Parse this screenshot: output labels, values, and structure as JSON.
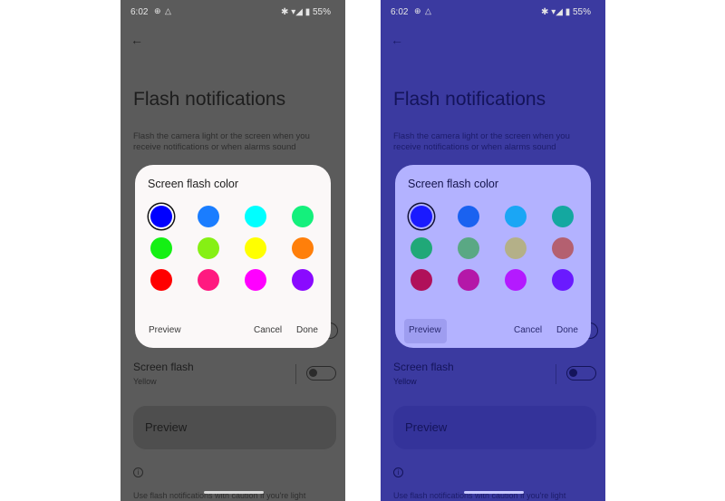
{
  "status": {
    "time": "6:02",
    "battery": "55%"
  },
  "page": {
    "title": "Flash notifications",
    "description": "Flash the camera light or the screen when you receive notifications or when alarms sound",
    "screen_flash_label": "Screen flash",
    "screen_flash_value": "Yellow",
    "preview_label": "Preview",
    "footer_text": "Use flash notifications with caution if you're light"
  },
  "dialog": {
    "title": "Screen flash color",
    "preview": "Preview",
    "cancel": "Cancel",
    "done": "Done"
  },
  "palettes": {
    "left": [
      "#0000ff",
      "#1a7dff",
      "#00ffff",
      "#14f07c",
      "#14f014",
      "#86f014",
      "#ffff00",
      "#ff7f0a",
      "#ff0000",
      "#ff1a80",
      "#ff00ff",
      "#8a0aff"
    ],
    "right": [
      "#1a1aff",
      "#1a62f0",
      "#1aa6f5",
      "#14a8a0",
      "#20a878",
      "#5aa884",
      "#b4b088",
      "#b46070",
      "#b0105a",
      "#b418a8",
      "#b41aff",
      "#6a1aff"
    ]
  },
  "selected_index": 0
}
